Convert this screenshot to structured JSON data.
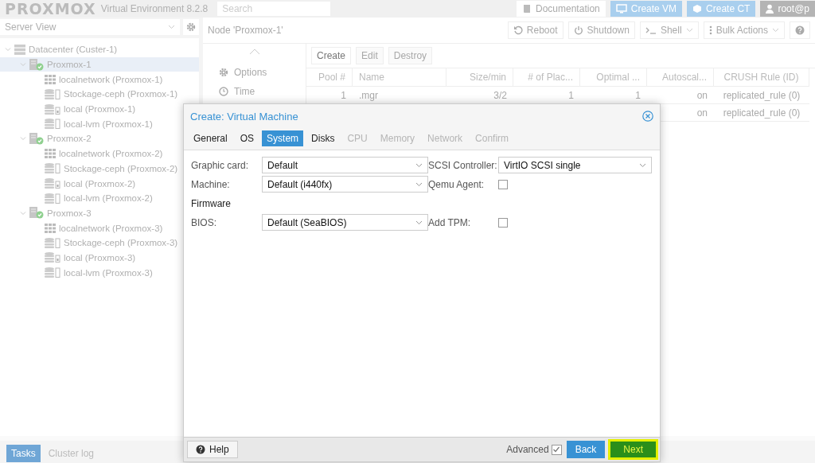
{
  "header": {
    "logo": "PROXMOX",
    "version": "Virtual Environment 8.2.8",
    "search": {
      "placeholder": "Search"
    },
    "buttons": [
      {
        "label": "Documentation",
        "kind": "doc"
      },
      {
        "label": "Create VM",
        "kind": "vm"
      },
      {
        "label": "Create CT",
        "kind": "ct"
      },
      {
        "label": "root@p",
        "kind": "user"
      }
    ]
  },
  "sidebar": {
    "view": "Server View",
    "tree": [
      {
        "label": "Datacenter (Custer-1)",
        "kind": "datacenter",
        "expanded": true,
        "selected": false,
        "children": [
          {
            "label": "Proxmox-1",
            "kind": "node",
            "expanded": true,
            "selected": true,
            "children": [
              {
                "label": "localnetwork (Proxmox-1)",
                "kind": "network",
                "selected": false
              },
              {
                "label": "Stockage-ceph (Proxmox-1)",
                "kind": "storage",
                "selected": false
              },
              {
                "label": "local (Proxmox-1)",
                "kind": "dir-storage",
                "selected": false
              },
              {
                "label": "local-lvm (Proxmox-1)",
                "kind": "storage",
                "selected": false
              }
            ]
          },
          {
            "label": "Proxmox-2",
            "kind": "node",
            "expanded": true,
            "selected": false,
            "children": [
              {
                "label": "localnetwork (Proxmox-2)",
                "kind": "network",
                "selected": false
              },
              {
                "label": "Stockage-ceph (Proxmox-2)",
                "kind": "storage",
                "selected": false
              },
              {
                "label": "local (Proxmox-2)",
                "kind": "dir-storage",
                "selected": false
              },
              {
                "label": "local-lvm (Proxmox-2)",
                "kind": "storage",
                "selected": false
              }
            ]
          },
          {
            "label": "Proxmox-3",
            "kind": "node",
            "expanded": true,
            "selected": false,
            "children": [
              {
                "label": "localnetwork (Proxmox-3)",
                "kind": "network",
                "selected": false
              },
              {
                "label": "Stockage-ceph (Proxmox-3)",
                "kind": "storage",
                "selected": false
              },
              {
                "label": "local (Proxmox-3)",
                "kind": "dir-storage",
                "selected": false
              },
              {
                "label": "local-lvm (Proxmox-3)",
                "kind": "storage",
                "selected": false
              }
            ]
          }
        ]
      }
    ]
  },
  "node_panel": {
    "title": "Node 'Proxmox-1'",
    "toolbar": [
      {
        "label": "Reboot",
        "kind": "reboot",
        "dropdown": false
      },
      {
        "label": "Shutdown",
        "kind": "power",
        "dropdown": false
      },
      {
        "label": "Shell",
        "kind": "shell",
        "dropdown": true
      },
      {
        "label": "Bulk Actions",
        "kind": "bulk",
        "dropdown": true
      },
      {
        "kind": "help",
        "dropdown": false
      }
    ],
    "submenu": [
      {
        "label": "Options",
        "kind": "gear"
      },
      {
        "label": "Time",
        "kind": "clock"
      }
    ],
    "grid_toolbar": [
      {
        "label": "Create",
        "disabled": false
      },
      {
        "label": "Edit",
        "disabled": true
      },
      {
        "label": "Destroy",
        "disabled": true
      }
    ],
    "table": {
      "columns": [
        "Pool #",
        "Name",
        "Size/min",
        "# of Plac...",
        "Optimal ...",
        "Autoscal...",
        "CRUSH Rule (ID)"
      ],
      "rows": [
        {
          "cells": [
            "1",
            ".mgr",
            "3/2",
            "1",
            "1",
            "on",
            "replicated_rule (0)"
          ]
        },
        {
          "cells": [
            "",
            "",
            "",
            "",
            "",
            "on",
            "replicated_rule (0)"
          ]
        }
      ]
    }
  },
  "bottom_panel": {
    "tabs": [
      {
        "label": "Tasks",
        "selected": true
      },
      {
        "label": "Cluster log",
        "selected": false
      }
    ]
  },
  "dialog": {
    "title": "Create: Virtual Machine",
    "tabs": [
      {
        "label": "General",
        "selected": false,
        "disabled": false
      },
      {
        "label": "OS",
        "selected": false,
        "disabled": false
      },
      {
        "label": "System",
        "selected": true,
        "disabled": false
      },
      {
        "label": "Disks",
        "selected": false,
        "disabled": false
      },
      {
        "label": "CPU",
        "selected": false,
        "disabled": true
      },
      {
        "label": "Memory",
        "selected": false,
        "disabled": true
      },
      {
        "label": "Network",
        "selected": false,
        "disabled": true
      },
      {
        "label": "Confirm",
        "selected": false,
        "disabled": true
      }
    ],
    "left_fields": [
      {
        "kind": "select",
        "label": "Graphic card:",
        "value": "Default"
      },
      {
        "kind": "select",
        "label": "Machine:",
        "value": "Default (i440fx)"
      },
      {
        "kind": "section",
        "label": "Firmware"
      },
      {
        "kind": "select",
        "label": "BIOS:",
        "value": "Default (SeaBIOS)"
      }
    ],
    "right_fields": [
      {
        "kind": "select",
        "label": "SCSI Controller:",
        "value": "VirtIO SCSI single"
      },
      {
        "kind": "checkbox",
        "label": "Qemu Agent:",
        "checked": false
      },
      {
        "kind": "spacer"
      },
      {
        "kind": "checkbox",
        "label": "Add TPM:",
        "checked": false
      }
    ],
    "footer": {
      "help": "Help",
      "advanced": {
        "label": "Advanced",
        "checked": true
      },
      "back": "Back",
      "next": {
        "label": "Next",
        "highlighted": true
      }
    }
  }
}
